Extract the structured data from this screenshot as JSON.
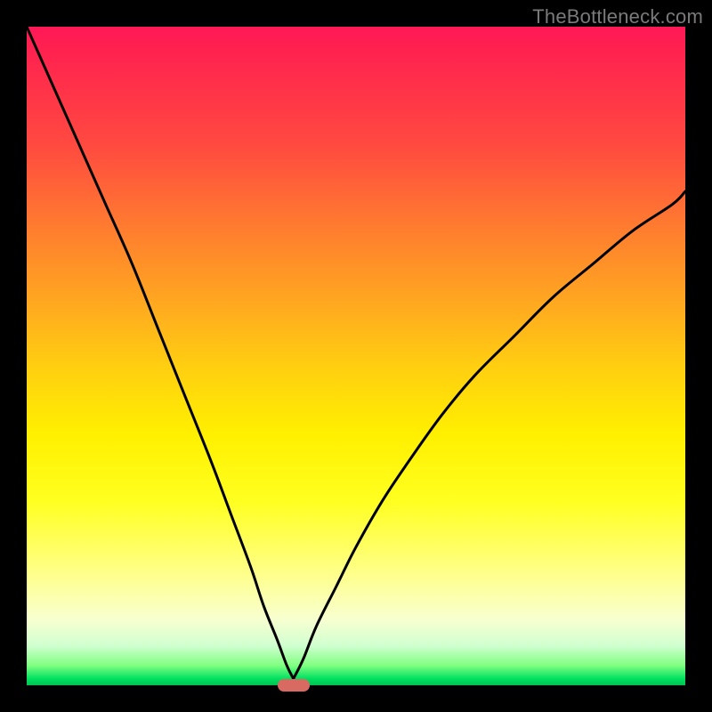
{
  "watermark": "TheBottleneck.com",
  "marker": {
    "x_percent": 40.5
  },
  "chart_data": {
    "type": "line",
    "title": "",
    "xlabel": "",
    "ylabel": "",
    "xlim": [
      0,
      100
    ],
    "ylim": [
      0,
      100
    ],
    "grid": false,
    "annotations": [],
    "background_gradient": {
      "orientation": "vertical",
      "stops": [
        {
          "pos": 0,
          "color": "#ff1858"
        },
        {
          "pos": 18,
          "color": "#ff4a40"
        },
        {
          "pos": 42,
          "color": "#ffa820"
        },
        {
          "pos": 62,
          "color": "#fff000"
        },
        {
          "pos": 90,
          "color": "#f8ffd0"
        },
        {
          "pos": 100,
          "color": "#00c050"
        }
      ]
    },
    "series": [
      {
        "name": "left-curve",
        "x": [
          0,
          4,
          8,
          12,
          16,
          20,
          24,
          28,
          31,
          34,
          36,
          38,
          39.5,
          40.5
        ],
        "y": [
          100,
          91,
          82,
          73,
          64,
          54,
          44,
          34,
          26,
          18,
          12,
          7,
          3,
          1
        ]
      },
      {
        "name": "right-curve",
        "x": [
          40.5,
          42,
          44,
          47,
          50,
          54,
          58,
          63,
          68,
          74,
          80,
          86,
          92,
          98,
          100
        ],
        "y": [
          1,
          4,
          9,
          15,
          21,
          28,
          34,
          41,
          47,
          53,
          59,
          64,
          69,
          73,
          75
        ]
      }
    ],
    "marker": {
      "x": 40.5,
      "y": 0,
      "shape": "pill",
      "color": "#d96a62"
    }
  }
}
